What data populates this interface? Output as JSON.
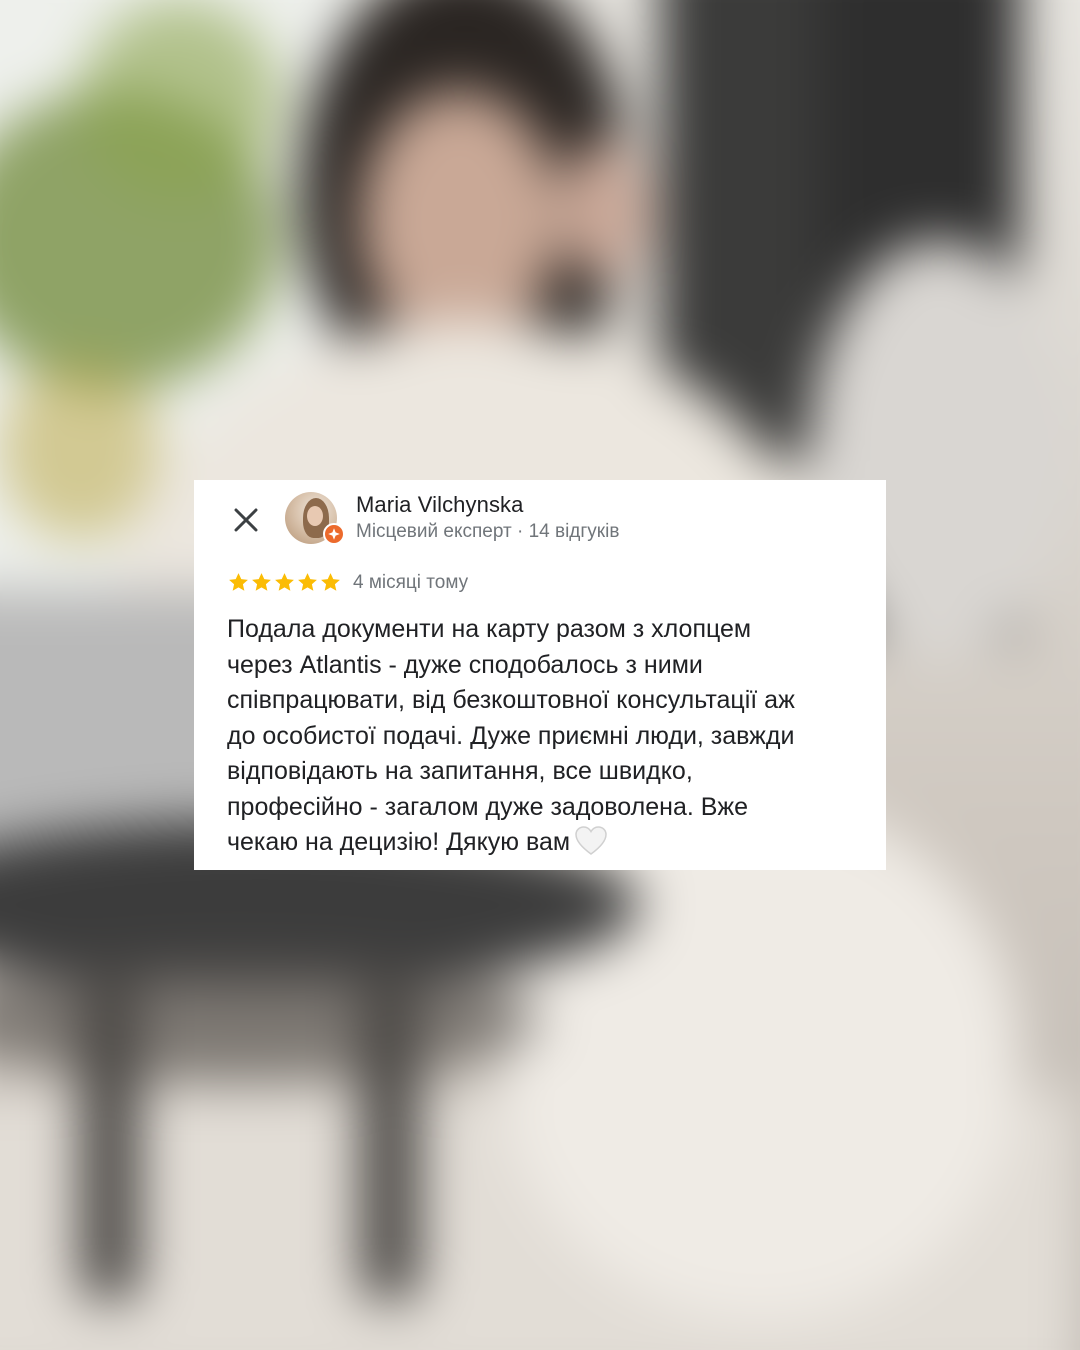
{
  "review": {
    "author": {
      "name": "Maria Vilchynska",
      "meta": "Місцевий експерт · 14 відгуків",
      "badge_color": "#ec6a2c"
    },
    "rating": {
      "value": 5,
      "max": 5,
      "star_color": "#fbbc04"
    },
    "time": "4 місяці тому",
    "text_lines": [
      "Подала документи на карту разом з хлопцем",
      "через Atlantis - дуже сподобалось з ними",
      "співпрацювати, від безкоштовної консультації аж",
      "до особистої подачі. Дуже приємні люди, завжди",
      "відповідають на запитання, все швидко,",
      "професійно - загалом дуже задоволена. Вже",
      "чекаю на децизію! Дякую вам"
    ],
    "emoji": "white-heart"
  },
  "icons": {
    "close": "close-icon",
    "badge": "local-guide-badge-icon",
    "star": "star-icon",
    "heart": "white-heart-icon"
  }
}
